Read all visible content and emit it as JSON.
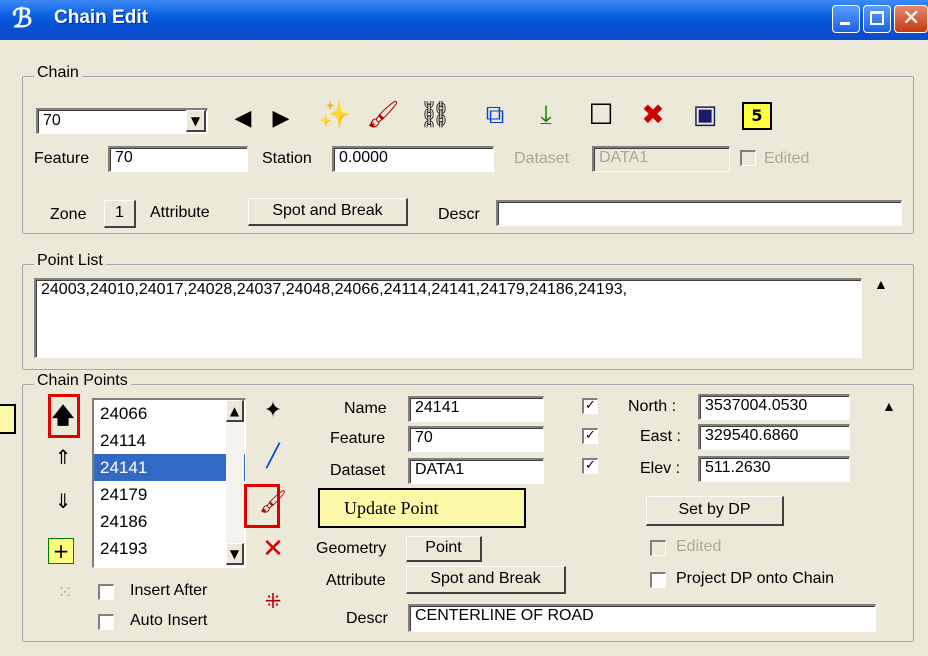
{
  "window": {
    "title": "Chain Edit"
  },
  "chain_group": {
    "label": "Chain",
    "chain_select": {
      "value": "70"
    },
    "toolbar_icons": [
      "prev-arrow-icon",
      "next-arrow-icon",
      "chain-wand-icon",
      "paint-brush-icon",
      "chain-link-icon",
      "select-box-icon",
      "download-arrow-icon",
      "new-box-icon",
      "delete-chain-icon",
      "chain-frame-icon",
      "dir-icon"
    ],
    "dir_icon_label": "5",
    "feature": {
      "label": "Feature",
      "value": "70"
    },
    "station": {
      "label": "Station",
      "value": "0.0000"
    },
    "dataset": {
      "label": "Dataset",
      "value": "DATA1"
    },
    "edited": {
      "label": "Edited"
    },
    "zone": {
      "label": "Zone",
      "value": "1"
    },
    "attribute": {
      "label": "Attribute",
      "value": "Spot and Break"
    },
    "descr": {
      "label": "Descr",
      "value": ""
    }
  },
  "point_list": {
    "label": "Point List",
    "value": "24003,24010,24017,24028,24037,24048,24066,24114,24141,24179,24186,24193,"
  },
  "chain_points": {
    "label": "Chain Points",
    "items": [
      "24066",
      "24114",
      "24141",
      "24179",
      "24186",
      "24193"
    ],
    "selected": "24141",
    "name": {
      "label": "Name",
      "value": "24141"
    },
    "feature": {
      "label": "Feature",
      "value": "70"
    },
    "dataset": {
      "label": "Dataset",
      "value": "DATA1"
    },
    "north": {
      "label": "North :",
      "value": "3537004.0530"
    },
    "east": {
      "label": "East :",
      "value": "329540.6860"
    },
    "elev": {
      "label": "Elev :",
      "value": "511.2630"
    },
    "set_by_dp": "Set by DP",
    "edited": {
      "label": "Edited"
    },
    "project_dp": {
      "label": "Project DP onto Chain"
    },
    "geometry": {
      "label": "Geometry",
      "value": "Point"
    },
    "attribute": {
      "label": "Attribute",
      "value": "Spot and Break"
    },
    "descr": {
      "label": "Descr",
      "value": "CENTERLINE OF ROAD"
    },
    "insert_after": {
      "label": "Insert After"
    },
    "auto_insert": {
      "label": "Auto Insert"
    }
  },
  "annotation": {
    "callout": "Update Point"
  },
  "colors": {
    "titlebar": "#0553d6",
    "highlight_box": "#e00000",
    "callout_bg": "#fbf9a8",
    "selection": "#316ac5"
  }
}
